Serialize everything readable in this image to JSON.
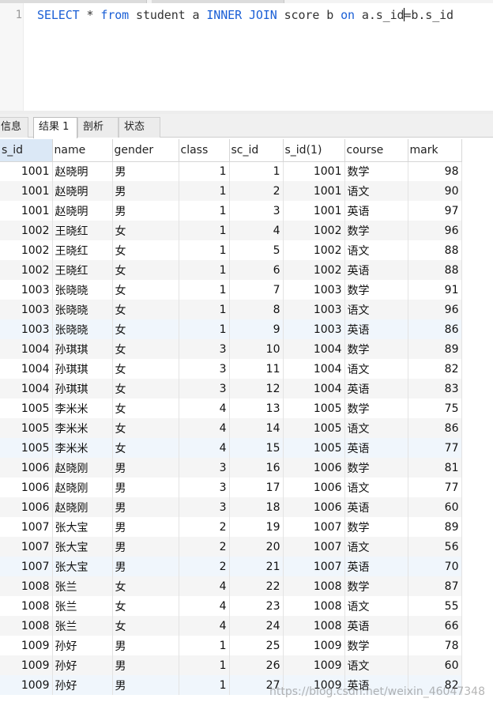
{
  "editor": {
    "line_number": "1",
    "sql": [
      {
        "t": "SELECT",
        "kw": true
      },
      {
        "t": " * ",
        "kw": false
      },
      {
        "t": "from",
        "kw": true
      },
      {
        "t": " student a ",
        "kw": false
      },
      {
        "t": "INNER JOIN",
        "kw": true
      },
      {
        "t": " score b ",
        "kw": false
      },
      {
        "t": "on",
        "kw": true
      },
      {
        "t": " a.s_id",
        "kw": false
      },
      {
        "t": "=b.s_id",
        "kw": false,
        "caret_before": true
      }
    ]
  },
  "tabs": [
    {
      "label": "信息",
      "active": false
    },
    {
      "label": "结果 1",
      "active": true
    },
    {
      "label": "剖析",
      "active": false
    },
    {
      "label": "状态",
      "active": false
    }
  ],
  "grid": {
    "columns": [
      "s_id",
      "name",
      "gender",
      "class",
      "sc_id",
      "s_id(1)",
      "course",
      "mark"
    ],
    "rows": [
      [
        "1001",
        "赵晓明",
        "男",
        "1",
        "1",
        "1001",
        "数学",
        "98"
      ],
      [
        "1001",
        "赵晓明",
        "男",
        "1",
        "2",
        "1001",
        "语文",
        "90"
      ],
      [
        "1001",
        "赵晓明",
        "男",
        "1",
        "3",
        "1001",
        "英语",
        "97"
      ],
      [
        "1002",
        "王晓红",
        "女",
        "1",
        "4",
        "1002",
        "数学",
        "96"
      ],
      [
        "1002",
        "王晓红",
        "女",
        "1",
        "5",
        "1002",
        "语文",
        "88"
      ],
      [
        "1002",
        "王晓红",
        "女",
        "1",
        "6",
        "1002",
        "英语",
        "88"
      ],
      [
        "1003",
        "张晓晓",
        "女",
        "1",
        "7",
        "1003",
        "数学",
        "91"
      ],
      [
        "1003",
        "张晓晓",
        "女",
        "1",
        "8",
        "1003",
        "语文",
        "96"
      ],
      [
        "1003",
        "张晓晓",
        "女",
        "1",
        "9",
        "1003",
        "英语",
        "86"
      ],
      [
        "1004",
        "孙琪琪",
        "女",
        "3",
        "10",
        "1004",
        "数学",
        "89"
      ],
      [
        "1004",
        "孙琪琪",
        "女",
        "3",
        "11",
        "1004",
        "语文",
        "82"
      ],
      [
        "1004",
        "孙琪琪",
        "女",
        "3",
        "12",
        "1004",
        "英语",
        "83"
      ],
      [
        "1005",
        "李米米",
        "女",
        "4",
        "13",
        "1005",
        "数学",
        "75"
      ],
      [
        "1005",
        "李米米",
        "女",
        "4",
        "14",
        "1005",
        "语文",
        "86"
      ],
      [
        "1005",
        "李米米",
        "女",
        "4",
        "15",
        "1005",
        "英语",
        "77"
      ],
      [
        "1006",
        "赵晓刚",
        "男",
        "3",
        "16",
        "1006",
        "数学",
        "81"
      ],
      [
        "1006",
        "赵晓刚",
        "男",
        "3",
        "17",
        "1006",
        "语文",
        "77"
      ],
      [
        "1006",
        "赵晓刚",
        "男",
        "3",
        "18",
        "1006",
        "英语",
        "60"
      ],
      [
        "1007",
        "张大宝",
        "男",
        "2",
        "19",
        "1007",
        "数学",
        "89"
      ],
      [
        "1007",
        "张大宝",
        "男",
        "2",
        "20",
        "1007",
        "语文",
        "56"
      ],
      [
        "1007",
        "张大宝",
        "男",
        "2",
        "21",
        "1007",
        "英语",
        "70"
      ],
      [
        "1008",
        "张兰",
        "女",
        "4",
        "22",
        "1008",
        "数学",
        "87"
      ],
      [
        "1008",
        "张兰",
        "女",
        "4",
        "23",
        "1008",
        "语文",
        "55"
      ],
      [
        "1008",
        "张兰",
        "女",
        "4",
        "24",
        "1008",
        "英语",
        "66"
      ],
      [
        "1009",
        "孙好",
        "男",
        "1",
        "25",
        "1009",
        "数学",
        "78"
      ],
      [
        "1009",
        "孙好",
        "男",
        "1",
        "26",
        "1009",
        "语文",
        "60"
      ],
      [
        "1009",
        "孙好",
        "男",
        "1",
        "27",
        "1009",
        "英语",
        "82"
      ]
    ]
  },
  "watermark": "https://blog.csdn.net/weixin_46047348",
  "colors": {
    "keyword": "#1a5fd6",
    "sorted_header_bg": "#dbe8f6",
    "row_alt_bg": "#f5f5f5"
  }
}
